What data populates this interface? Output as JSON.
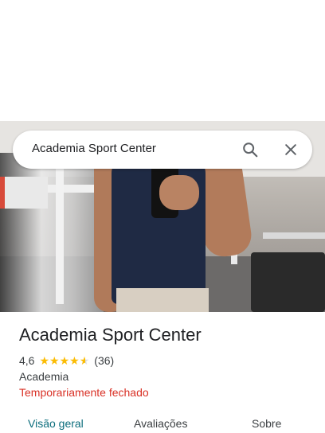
{
  "search": {
    "query": "Academia Sport Center"
  },
  "place": {
    "name": "Academia Sport Center",
    "rating": "4,6",
    "rating_stars": 4.6,
    "review_count": "(36)",
    "category": "Academia",
    "status": "Temporariamente fechado"
  },
  "tabs": [
    {
      "label": "Visão geral",
      "active": true
    },
    {
      "label": "Avaliações",
      "active": false
    },
    {
      "label": "Sobre",
      "active": false
    }
  ],
  "colors": {
    "status_red": "#d93025",
    "star_gold": "#fbbc04",
    "tab_active": "#0b6d7c"
  },
  "icons": {
    "search": "search-icon",
    "close": "close-icon"
  }
}
